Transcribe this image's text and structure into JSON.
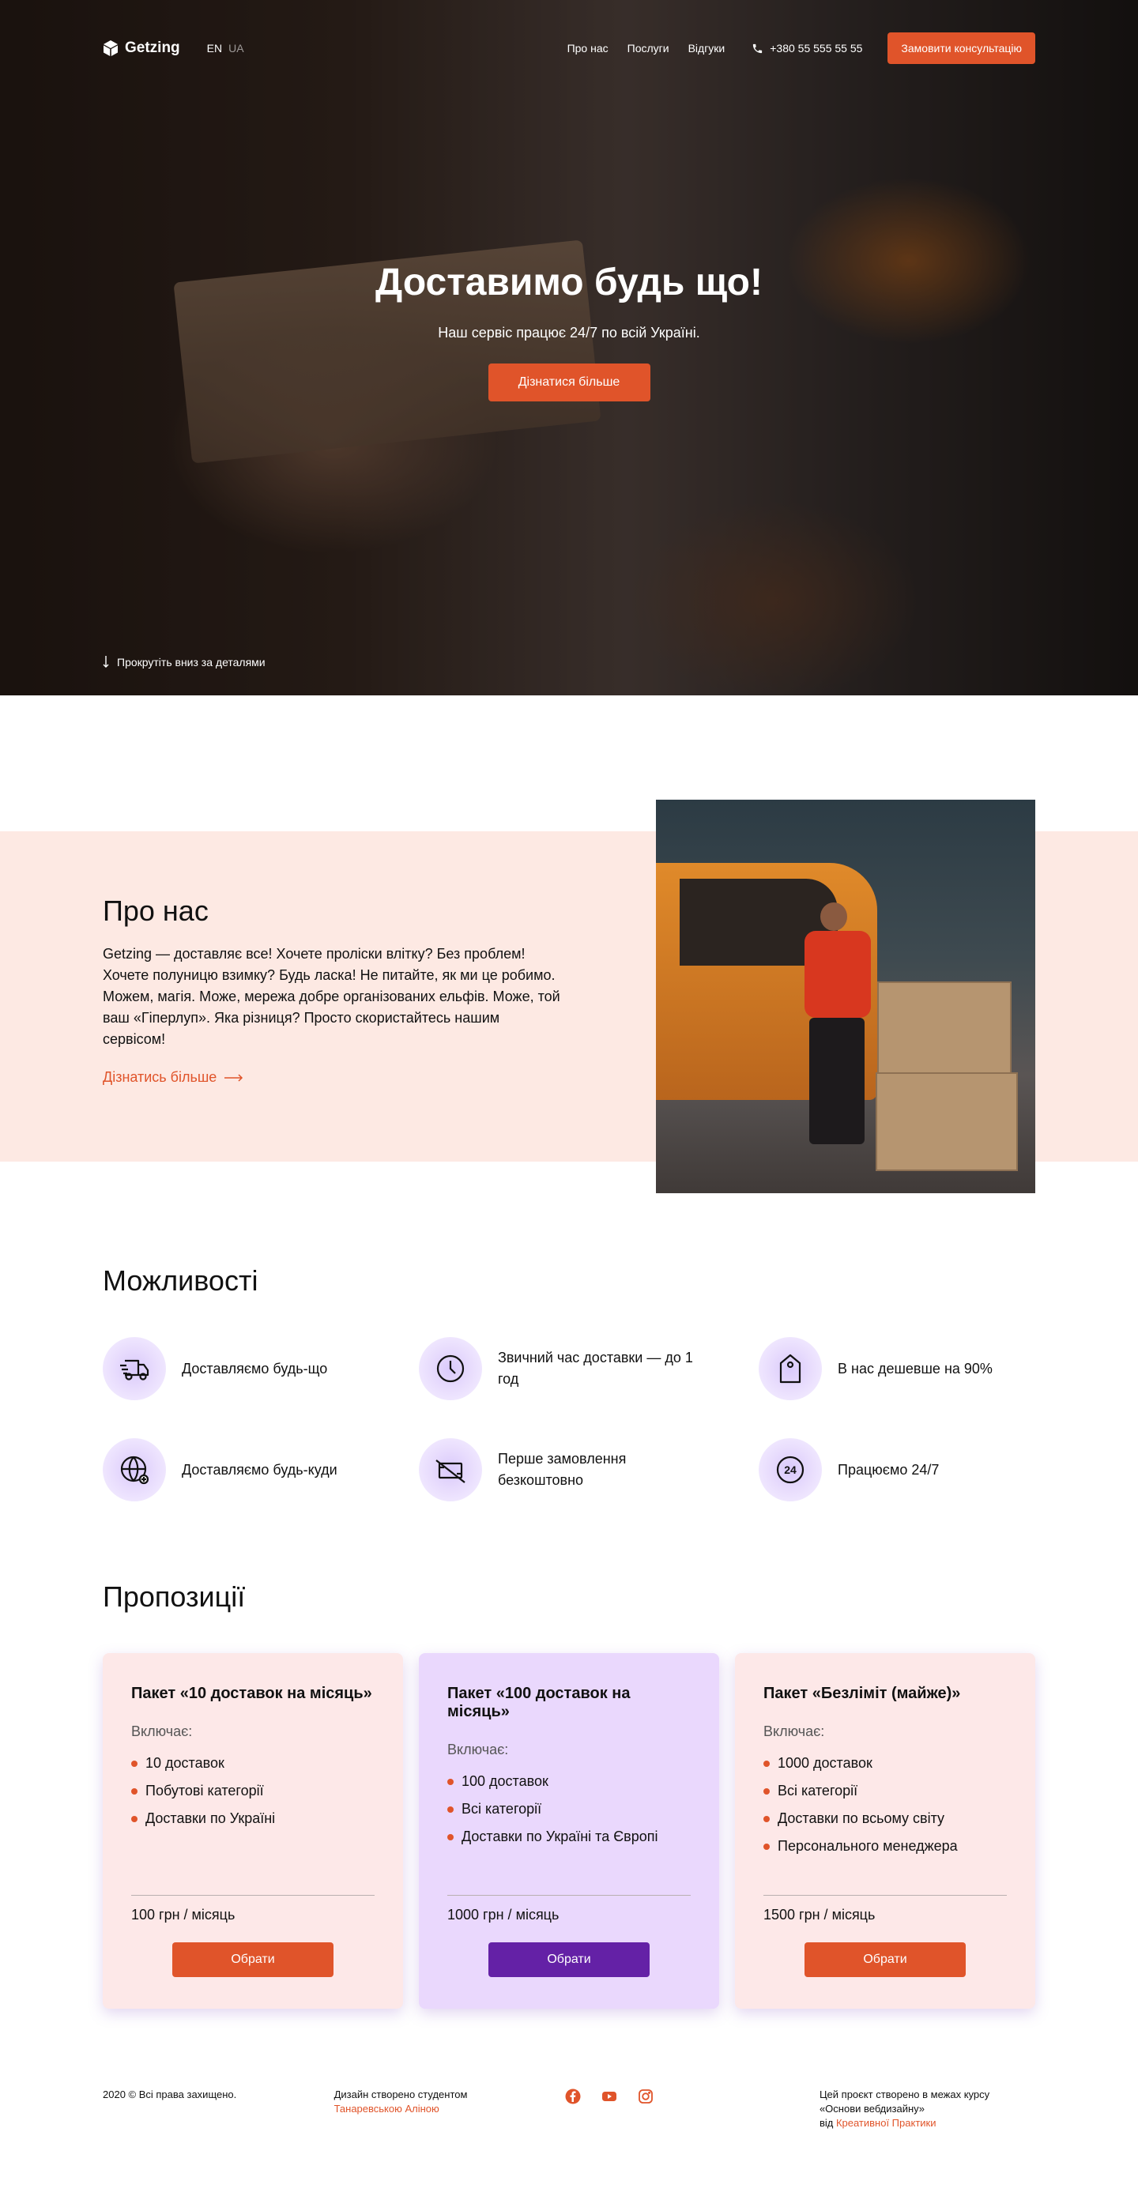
{
  "brand": {
    "name": "Getzing",
    "accent_color": "#e0542a",
    "purple_color": "#6421a6"
  },
  "nav": {
    "lang_en": "EN",
    "lang_ua": "UA",
    "links": [
      "Про нас",
      "Послуги",
      "Відгуки"
    ],
    "phone": "+380 55 555 55 55",
    "cta": "Замовити консультацію"
  },
  "hero": {
    "title": "Доставимо будь що!",
    "subtitle": "Наш сервіс працює 24/7 по всій Україні.",
    "button": "Дізнатися більше",
    "scroll_hint": "Прокрутіть вниз за деталями"
  },
  "about": {
    "title": "Про нас",
    "text": "Getzing — доставляє все! Хочете проліски влітку? Без проблем! Хочете полуницю взимку? Будь ласка! Не питайте, як ми це робимо. Можем, магія. Може, мережа добре організованих ельфів. Може, той ваш «Гіперлуп». Яка різниця? Просто скористайтесь нашим сервісом!",
    "link": "Дізнатись більше"
  },
  "features": {
    "title": "Можливості",
    "items": [
      {
        "icon": "truck-icon",
        "text": "Доставляємо будь-що"
      },
      {
        "icon": "clock-icon",
        "text": "Звичний час доставки — до 1 год"
      },
      {
        "icon": "price-tag-icon",
        "text": "В нас дешевше на 90%"
      },
      {
        "icon": "globe-icon",
        "text": "Доставляємо будь-куди"
      },
      {
        "icon": "free-money-icon",
        "text": "Перше замовлення безкоштовно"
      },
      {
        "icon": "24h-icon",
        "text": "Працюємо 24/7"
      }
    ]
  },
  "offers": {
    "title": "Пропозиції",
    "includes_label": "Включає:",
    "cards": [
      {
        "title": "Пакет «10 доставок на місяць»",
        "items": [
          "10 доставок",
          "Побутові категорії",
          "Доставки по Україні"
        ],
        "price": "100 грн / місяць",
        "button": "Обрати"
      },
      {
        "title": "Пакет «100 доставок на місяць»",
        "items": [
          "100 доставок",
          "Всі категорії",
          "Доставки по Україні та Європі"
        ],
        "price": "1000 грн / місяць",
        "button": "Обрати"
      },
      {
        "title": "Пакет «Безліміт (майже)»",
        "items": [
          "1000 доставок",
          "Всі категорії",
          "Доставки по всьому світу",
          "Персонального менеджера"
        ],
        "price": "1500 грн / місяць",
        "button": "Обрати"
      }
    ]
  },
  "footer": {
    "copyright": "2020 © Всі права захищено.",
    "design_line": "Дизайн створено студентом",
    "design_author": "Танаревською Аліною",
    "project_line1": "Цей проєкт створено в межах курсу",
    "project_line2": "«Основи вебдизайну»",
    "project_from": "від",
    "project_org": "Креативної Практики"
  }
}
